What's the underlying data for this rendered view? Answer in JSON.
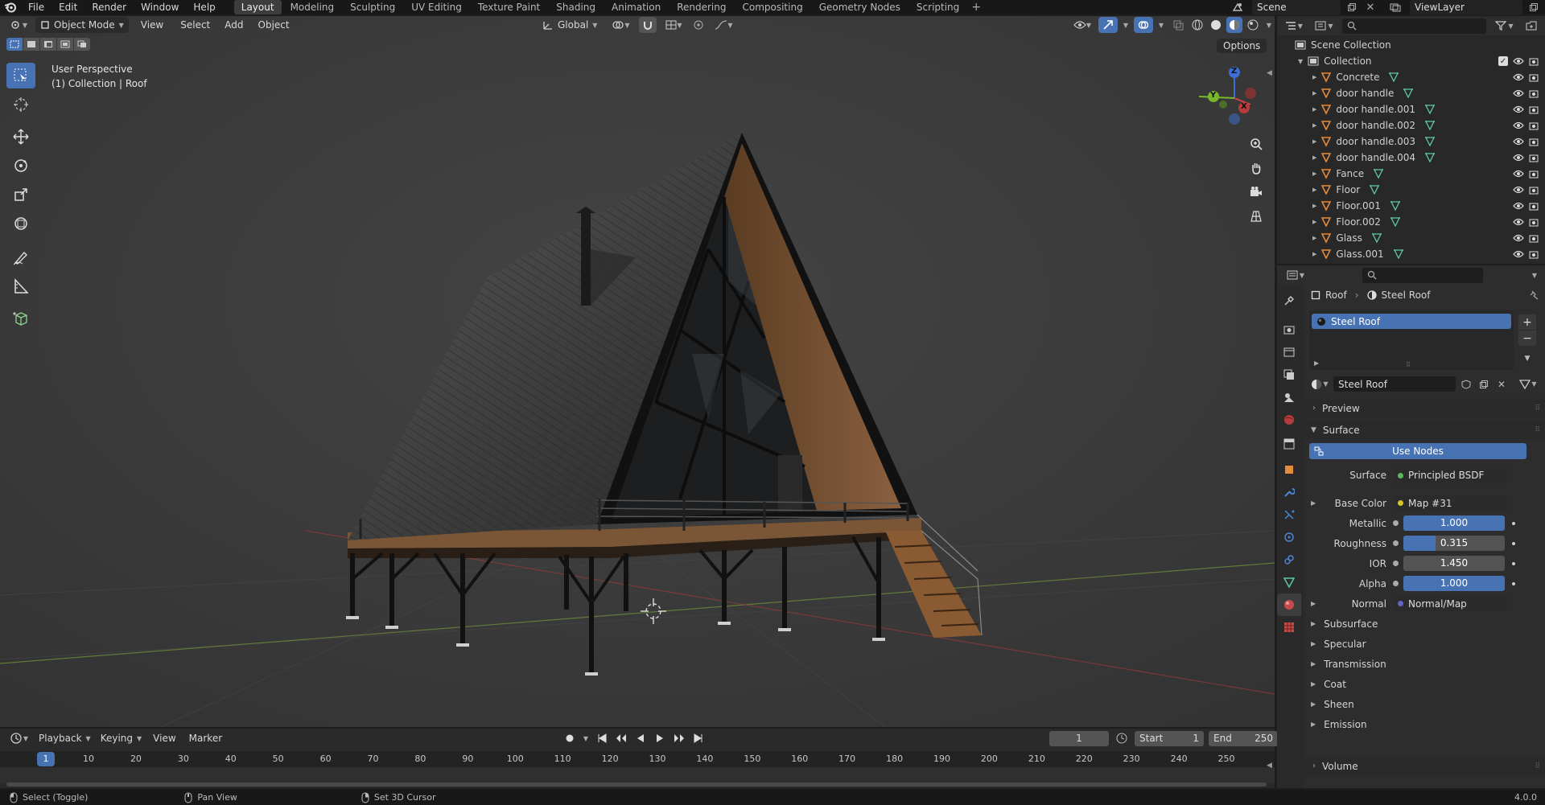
{
  "menu": {
    "items": [
      "File",
      "Edit",
      "Render",
      "Window",
      "Help"
    ],
    "workspaces": [
      "Layout",
      "Modeling",
      "Sculpting",
      "UV Editing",
      "Texture Paint",
      "Shading",
      "Animation",
      "Rendering",
      "Compositing",
      "Geometry Nodes",
      "Scripting"
    ],
    "active_workspace": "Layout",
    "scene": "Scene",
    "view_layer": "ViewLayer"
  },
  "viewport": {
    "mode": "Object Mode",
    "menus": [
      "View",
      "Select",
      "Add",
      "Object"
    ],
    "transform_orientation": "Global",
    "options_label": "Options",
    "overlay_title": "User Perspective",
    "overlay_sub": "(1) Collection | Roof",
    "gizmo": {
      "x": "X",
      "y": "Y",
      "z": "Z"
    }
  },
  "outliner": {
    "root": "Scene Collection",
    "collection": "Collection",
    "items": [
      "Concrete",
      "door handle",
      "door handle.001",
      "door handle.002",
      "door handle.003",
      "door handle.004",
      "Fance",
      "Floor",
      "Floor.001",
      "Floor.002",
      "Glass",
      "Glass.001"
    ]
  },
  "properties": {
    "breadcrumb_object": "Roof",
    "breadcrumb_material": "Steel Roof",
    "slot_name": "Steel Roof",
    "material_name": "Steel Roof",
    "panel_preview": "Preview",
    "panel_surface": "Surface",
    "use_nodes": "Use Nodes",
    "surface_label": "Surface",
    "surface_value": "Principled BSDF",
    "base_color_label": "Base Color",
    "base_color_value": "Map #31",
    "metallic_label": "Metallic",
    "metallic_value": "1.000",
    "metallic_fraction": 1.0,
    "roughness_label": "Roughness",
    "roughness_value": "0.315",
    "roughness_fraction": 0.315,
    "ior_label": "IOR",
    "ior_value": "1.450",
    "alpha_label": "Alpha",
    "alpha_value": "1.000",
    "alpha_fraction": 1.0,
    "normal_label": "Normal",
    "normal_value": "Normal/Map",
    "subpanels": [
      "Subsurface",
      "Specular",
      "Transmission",
      "Coat",
      "Sheen",
      "Emission"
    ],
    "volume": "Volume"
  },
  "timeline": {
    "menus": [
      "Playback",
      "Keying",
      "View",
      "Marker"
    ],
    "current_frame": "1",
    "start_label": "Start",
    "start_value": "1",
    "end_label": "End",
    "end_value": "250",
    "ticks": [
      "1",
      "10",
      "20",
      "30",
      "40",
      "50",
      "60",
      "70",
      "80",
      "90",
      "100",
      "110",
      "120",
      "130",
      "140",
      "150",
      "160",
      "170",
      "180",
      "190",
      "200",
      "210",
      "220",
      "230",
      "240",
      "250"
    ]
  },
  "statusbar": {
    "select": "Select (Toggle)",
    "pan": "Pan View",
    "cursor": "Set 3D Cursor",
    "version": "4.0.0"
  },
  "colors": {
    "accent": "#4772b3",
    "mesh_icon": "#e58b3a",
    "data_icon": "#5fc7a4",
    "frame_marker": "#4772b3"
  }
}
